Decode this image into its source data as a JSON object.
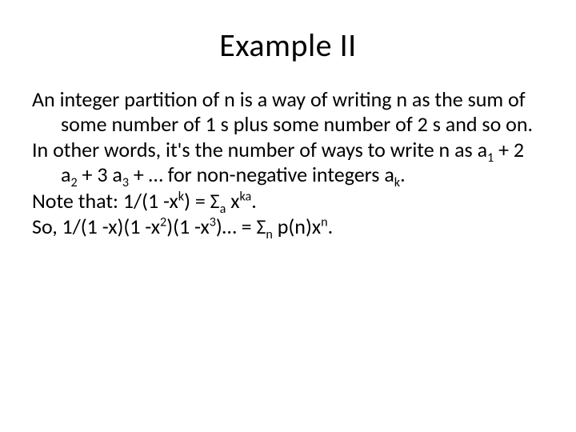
{
  "slide": {
    "title": "Example II",
    "p1_a": "An integer partition of n is a way of writing n as the sum of some number of 1 s plus some number of 2 s and so on.",
    "p2_a": "In other words, it's the number of ways to write n as a",
    "p2_b": "1",
    "p2_c": " + 2 a",
    "p2_d": "2",
    "p2_e": " + 3 a",
    "p2_f": "3",
    "p2_g": " + … for non-negative integers a",
    "p2_h": "k",
    "p2_i": ".",
    "p3_a": "Note that: 1/(1 -x",
    "p3_b": "k",
    "p3_c": ") = Σ",
    "p3_d": "a",
    "p3_e": " x",
    "p3_f": "ka",
    "p3_g": ".",
    "p4_a": "So, 1/(1 -x)(1 -x",
    "p4_b": "2",
    "p4_c": ")(1 -x",
    "p4_d": "3",
    "p4_e": ")… = Σ",
    "p4_f": "n",
    "p4_g": " p(n)x",
    "p4_h": "n",
    "p4_i": "."
  }
}
